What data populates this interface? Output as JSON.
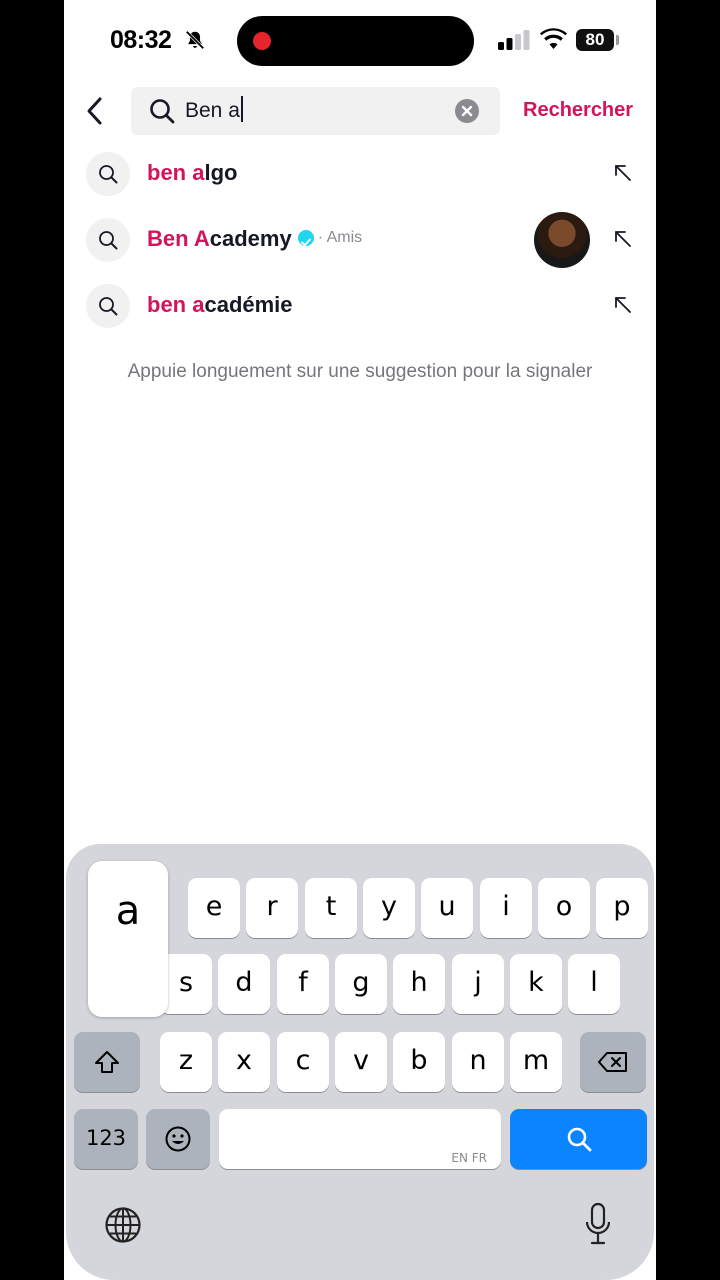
{
  "status_bar": {
    "time": "08:32",
    "battery": "80"
  },
  "search": {
    "query": "Ben a",
    "action_label": "Rechercher"
  },
  "suggestions": [
    {
      "highlight": "ben a",
      "rest": "lgo"
    },
    {
      "highlight": "Ben A",
      "rest": "cademy",
      "sub": "· Amis",
      "verified": true
    },
    {
      "highlight": "ben a",
      "rest": "cadémie"
    }
  ],
  "hint": "Appuie longuement sur une suggestion pour la signaler",
  "keyboard": {
    "popup_key": "a",
    "row1": [
      "e",
      "r",
      "t",
      "y",
      "u",
      "i",
      "o",
      "p"
    ],
    "row2": [
      "s",
      "d",
      "f",
      "g",
      "h",
      "j",
      "k",
      "l"
    ],
    "row3": [
      "z",
      "x",
      "c",
      "v",
      "b",
      "n",
      "m"
    ],
    "numbers_label": "123",
    "space_lang": "EN FR"
  },
  "colors": {
    "accent": "#d4145a",
    "verified": "#20d5ec",
    "search_key": "#0a84ff"
  }
}
